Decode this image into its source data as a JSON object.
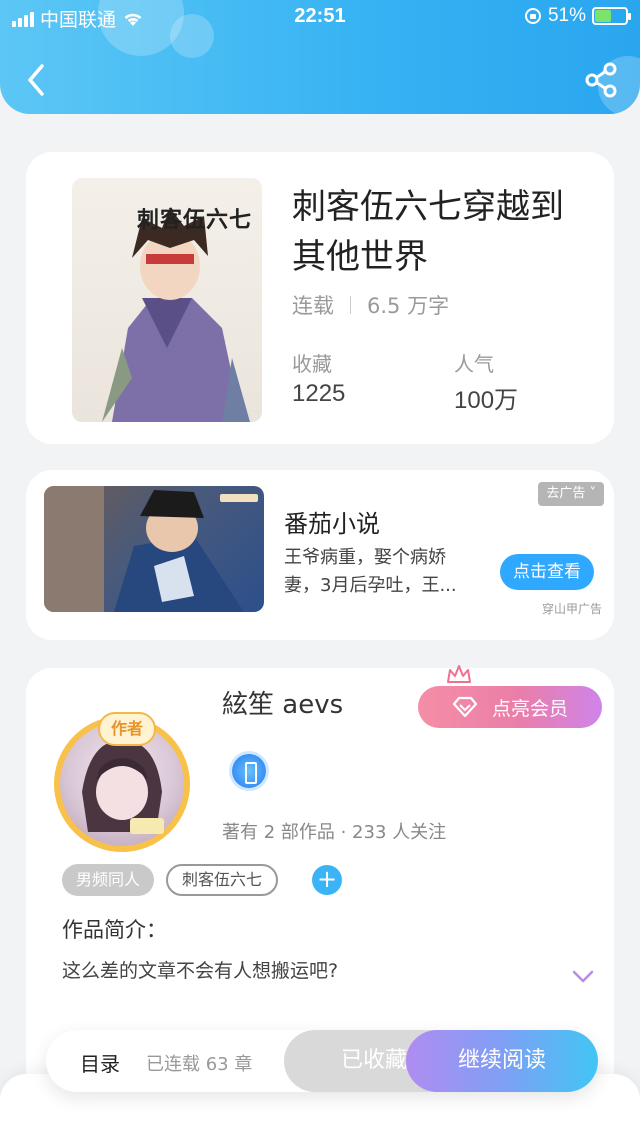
{
  "status_bar": {
    "carrier": "中国联通",
    "time": "22:51",
    "battery_percent": "51%",
    "battery_level": 0.51
  },
  "header": {
    "back_icon": "chevron-left-icon",
    "share_icon": "share-icon",
    "gradient": [
      "#5cc7f5",
      "#2aa6ef"
    ]
  },
  "book": {
    "cover_title": "刺客伍六七",
    "title": "刺客伍六七穿越到其他世界",
    "status": "连载",
    "word_count": "6.5 万字",
    "stats": [
      {
        "label": "收藏",
        "value": "1225"
      },
      {
        "label": "人气",
        "value": "100万"
      }
    ]
  },
  "ad": {
    "remove_label": "去广告 ˅",
    "app_name": "番茄小说",
    "description": "王爷病重，娶个病娇妻，3月后孕吐，王...",
    "cta": "点击查看",
    "source": "穿山甲广告",
    "cta_color": "#2fa8ff"
  },
  "author": {
    "badge": "作者",
    "name": "絃笙 aevs",
    "vip_label": "点亮会员",
    "works_info": "著有 2 部作品 · 233 人关注",
    "tags": [
      "男频同人",
      "刺客伍六七"
    ],
    "intro_label": "作品简介：",
    "intro": "这么差的文章不会有人想搬运吧?"
  },
  "bottom_bar": {
    "toc_label": "目录",
    "chapters": "已连载 63 章",
    "collected_label": "已收藏",
    "read_label": "继续阅读"
  }
}
